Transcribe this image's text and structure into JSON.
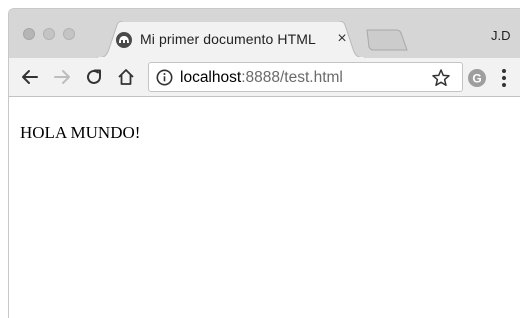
{
  "window": {
    "traffic_lights": [
      "close",
      "minimize",
      "maximize"
    ]
  },
  "tab": {
    "title": "Mi primer documento HTML",
    "favicon": "globe-icon",
    "close_glyph": "×"
  },
  "profile": {
    "initials": "J.D"
  },
  "toolbar": {
    "back_icon": "arrow-left-icon",
    "forward_icon": "arrow-right-icon",
    "reload_icon": "reload-icon",
    "home_icon": "home-icon"
  },
  "address": {
    "host": "localhost",
    "rest": ":8888/test.html",
    "info_icon": "info-icon",
    "bookmark_icon": "star-icon"
  },
  "extensions": {
    "icon": "extension-g-icon",
    "letter": "G"
  },
  "page": {
    "body_text": "HOLA MUNDO!"
  }
}
